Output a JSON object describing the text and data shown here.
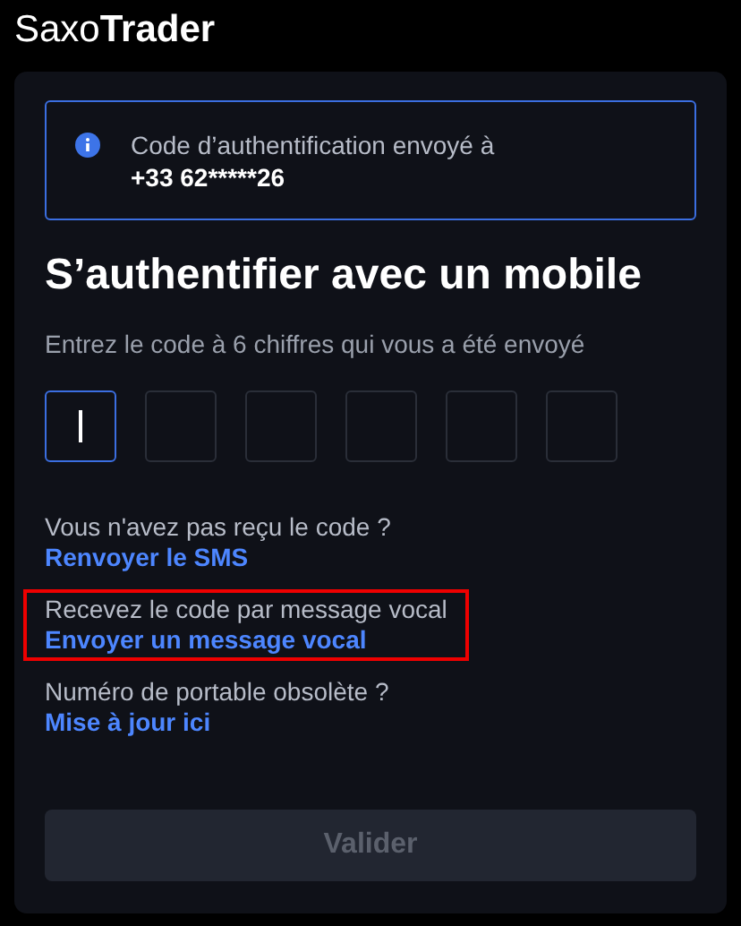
{
  "logo": "Saxo**Trader**",
  "alert": {
    "message": "Code d’authentification envoyé à",
    "phone": "+33 62*****26"
  },
  "title": "S’authentifier avec un mobile",
  "instruction": "Entrez le code à 6 chiffres qui vous a été envoyé",
  "code_boxes": [
    {
      "focused": true
    },
    {
      "focused": false
    },
    {
      "focused": false
    },
    {
      "focused": false
    },
    {
      "focused": false
    },
    {
      "focused": false
    }
  ],
  "options": [
    {
      "question": "Vous n'avez pas reçu le code ?",
      "link": "Renvoyer le SMS",
      "highlighted": false
    },
    {
      "question": "Recevez le code par message vocal",
      "link": "Envoyer un message vocal",
      "highlighted": true
    },
    {
      "question": "Numéro de portable obsolète ?",
      "link": "Mise à jour ici",
      "highlighted": false
    }
  ],
  "submit": {
    "label": "Valider",
    "disabled": true
  }
}
